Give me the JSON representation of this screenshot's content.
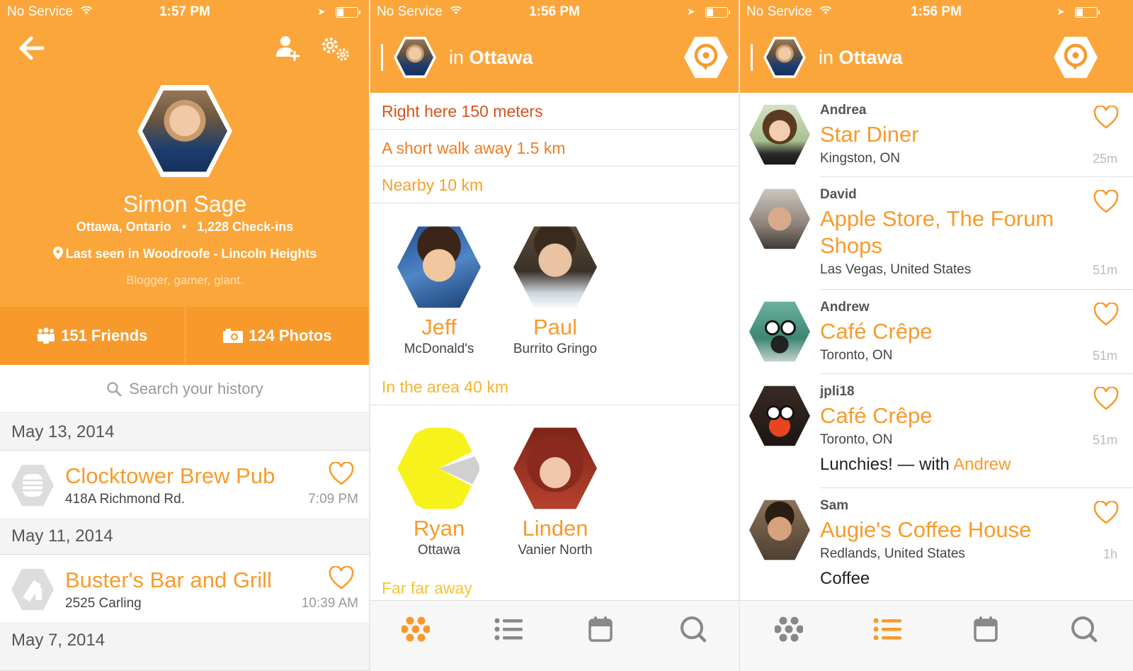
{
  "status_bars": [
    {
      "carrier": "No Service",
      "time": "1:57 PM"
    },
    {
      "carrier": "No Service",
      "time": "1:56 PM"
    },
    {
      "carrier": "No Service",
      "time": "1:56 PM"
    }
  ],
  "profile": {
    "name": "Simon Sage",
    "location": "Ottawa, Ontario",
    "checkins": "1,228 Check-ins",
    "last_seen": "Last seen in Woodroofe - Lincoln Heights",
    "bio": "Blogger, gamer, giant.",
    "friends": "151 Friends",
    "photos": "124 Photos",
    "search_placeholder": "Search your history"
  },
  "history": [
    {
      "date": "May 13, 2014",
      "venue": "Clocktower Brew Pub",
      "address": "418A Richmond Rd.",
      "time": "7:09 PM",
      "icon": "beer-barrel-icon"
    },
    {
      "date": "May 11, 2014",
      "venue": "Buster's Bar and Grill",
      "address": "2525 Carling",
      "time": "10:39 AM",
      "icon": "bar-grill-icon"
    },
    {
      "date": "May 7, 2014"
    }
  ],
  "nav": {
    "prefix": "in",
    "city": "Ottawa"
  },
  "distances": [
    {
      "label": "Right here",
      "value": "150 meters",
      "color": "#d9531e"
    },
    {
      "label": "A short walk away",
      "value": "1.5 km",
      "color": "#ef7d22"
    },
    {
      "label": "Nearby",
      "value": "10 km",
      "color": "#f5a02a"
    },
    {
      "label": "In the area",
      "value": "40 km",
      "color": "#f7b32e"
    },
    {
      "label": "Far far away",
      "value": "",
      "color": "#f9c52f"
    }
  ],
  "nearby_friends": [
    {
      "name": "Jeff",
      "place": "McDonald's"
    },
    {
      "name": "Paul",
      "place": "Burrito Gringo"
    },
    {
      "name": "Ryan",
      "place": "Ottawa"
    },
    {
      "name": "Linden",
      "place": "Vanier North"
    }
  ],
  "feed": [
    {
      "user": "Andrea",
      "venue": "Star Diner",
      "location": "Kingston, ON",
      "distance": "25m"
    },
    {
      "user": "David",
      "venue": "Apple Store, The Forum Shops",
      "location": "Las Vegas, United States",
      "distance": "51m"
    },
    {
      "user": "Andrew",
      "venue": "Café Crêpe",
      "location": "Toronto, ON",
      "distance": "51m"
    },
    {
      "user": "jpli18",
      "venue": "Café Crêpe",
      "location": "Toronto, ON",
      "distance": "51m",
      "shout": "Lunchies! —",
      "shout_with": "with",
      "shout_friend": "Andrew"
    },
    {
      "user": "Sam",
      "venue": "Augie's Coffee House",
      "location": "Redlands, United States",
      "distance": "1h",
      "shout": "Coffee"
    }
  ],
  "colors": {
    "accent": "#fba63b",
    "accent_dark": "#f89a2b"
  }
}
